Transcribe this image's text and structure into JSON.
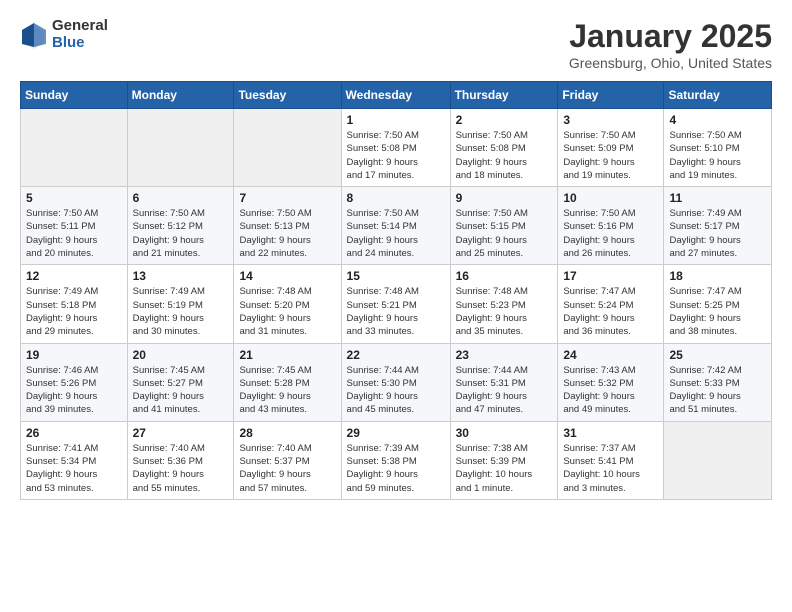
{
  "logo": {
    "general": "General",
    "blue": "Blue"
  },
  "header": {
    "month": "January 2025",
    "location": "Greensburg, Ohio, United States"
  },
  "weekdays": [
    "Sunday",
    "Monday",
    "Tuesday",
    "Wednesday",
    "Thursday",
    "Friday",
    "Saturday"
  ],
  "weeks": [
    [
      {
        "day": "",
        "info": ""
      },
      {
        "day": "",
        "info": ""
      },
      {
        "day": "",
        "info": ""
      },
      {
        "day": "1",
        "info": "Sunrise: 7:50 AM\nSunset: 5:08 PM\nDaylight: 9 hours\nand 17 minutes."
      },
      {
        "day": "2",
        "info": "Sunrise: 7:50 AM\nSunset: 5:08 PM\nDaylight: 9 hours\nand 18 minutes."
      },
      {
        "day": "3",
        "info": "Sunrise: 7:50 AM\nSunset: 5:09 PM\nDaylight: 9 hours\nand 19 minutes."
      },
      {
        "day": "4",
        "info": "Sunrise: 7:50 AM\nSunset: 5:10 PM\nDaylight: 9 hours\nand 19 minutes."
      }
    ],
    [
      {
        "day": "5",
        "info": "Sunrise: 7:50 AM\nSunset: 5:11 PM\nDaylight: 9 hours\nand 20 minutes."
      },
      {
        "day": "6",
        "info": "Sunrise: 7:50 AM\nSunset: 5:12 PM\nDaylight: 9 hours\nand 21 minutes."
      },
      {
        "day": "7",
        "info": "Sunrise: 7:50 AM\nSunset: 5:13 PM\nDaylight: 9 hours\nand 22 minutes."
      },
      {
        "day": "8",
        "info": "Sunrise: 7:50 AM\nSunset: 5:14 PM\nDaylight: 9 hours\nand 24 minutes."
      },
      {
        "day": "9",
        "info": "Sunrise: 7:50 AM\nSunset: 5:15 PM\nDaylight: 9 hours\nand 25 minutes."
      },
      {
        "day": "10",
        "info": "Sunrise: 7:50 AM\nSunset: 5:16 PM\nDaylight: 9 hours\nand 26 minutes."
      },
      {
        "day": "11",
        "info": "Sunrise: 7:49 AM\nSunset: 5:17 PM\nDaylight: 9 hours\nand 27 minutes."
      }
    ],
    [
      {
        "day": "12",
        "info": "Sunrise: 7:49 AM\nSunset: 5:18 PM\nDaylight: 9 hours\nand 29 minutes."
      },
      {
        "day": "13",
        "info": "Sunrise: 7:49 AM\nSunset: 5:19 PM\nDaylight: 9 hours\nand 30 minutes."
      },
      {
        "day": "14",
        "info": "Sunrise: 7:48 AM\nSunset: 5:20 PM\nDaylight: 9 hours\nand 31 minutes."
      },
      {
        "day": "15",
        "info": "Sunrise: 7:48 AM\nSunset: 5:21 PM\nDaylight: 9 hours\nand 33 minutes."
      },
      {
        "day": "16",
        "info": "Sunrise: 7:48 AM\nSunset: 5:23 PM\nDaylight: 9 hours\nand 35 minutes."
      },
      {
        "day": "17",
        "info": "Sunrise: 7:47 AM\nSunset: 5:24 PM\nDaylight: 9 hours\nand 36 minutes."
      },
      {
        "day": "18",
        "info": "Sunrise: 7:47 AM\nSunset: 5:25 PM\nDaylight: 9 hours\nand 38 minutes."
      }
    ],
    [
      {
        "day": "19",
        "info": "Sunrise: 7:46 AM\nSunset: 5:26 PM\nDaylight: 9 hours\nand 39 minutes."
      },
      {
        "day": "20",
        "info": "Sunrise: 7:45 AM\nSunset: 5:27 PM\nDaylight: 9 hours\nand 41 minutes."
      },
      {
        "day": "21",
        "info": "Sunrise: 7:45 AM\nSunset: 5:28 PM\nDaylight: 9 hours\nand 43 minutes."
      },
      {
        "day": "22",
        "info": "Sunrise: 7:44 AM\nSunset: 5:30 PM\nDaylight: 9 hours\nand 45 minutes."
      },
      {
        "day": "23",
        "info": "Sunrise: 7:44 AM\nSunset: 5:31 PM\nDaylight: 9 hours\nand 47 minutes."
      },
      {
        "day": "24",
        "info": "Sunrise: 7:43 AM\nSunset: 5:32 PM\nDaylight: 9 hours\nand 49 minutes."
      },
      {
        "day": "25",
        "info": "Sunrise: 7:42 AM\nSunset: 5:33 PM\nDaylight: 9 hours\nand 51 minutes."
      }
    ],
    [
      {
        "day": "26",
        "info": "Sunrise: 7:41 AM\nSunset: 5:34 PM\nDaylight: 9 hours\nand 53 minutes."
      },
      {
        "day": "27",
        "info": "Sunrise: 7:40 AM\nSunset: 5:36 PM\nDaylight: 9 hours\nand 55 minutes."
      },
      {
        "day": "28",
        "info": "Sunrise: 7:40 AM\nSunset: 5:37 PM\nDaylight: 9 hours\nand 57 minutes."
      },
      {
        "day": "29",
        "info": "Sunrise: 7:39 AM\nSunset: 5:38 PM\nDaylight: 9 hours\nand 59 minutes."
      },
      {
        "day": "30",
        "info": "Sunrise: 7:38 AM\nSunset: 5:39 PM\nDaylight: 10 hours\nand 1 minute."
      },
      {
        "day": "31",
        "info": "Sunrise: 7:37 AM\nSunset: 5:41 PM\nDaylight: 10 hours\nand 3 minutes."
      },
      {
        "day": "",
        "info": ""
      }
    ]
  ]
}
